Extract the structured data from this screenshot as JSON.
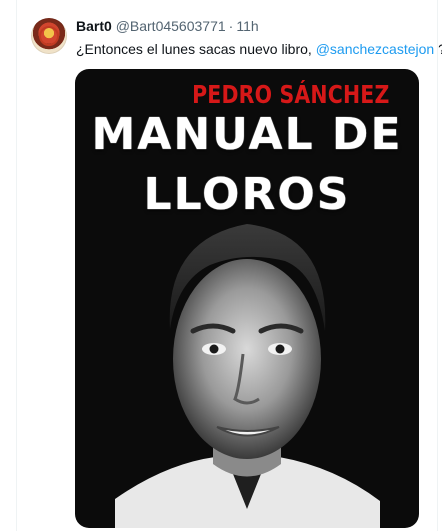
{
  "tweet": {
    "author_name": "Bart0",
    "handle": "@Bart045603771",
    "separator": "·",
    "time": "11h",
    "text_before": "¿Entonces el lunes sacas nuevo libro, ",
    "mention": "@sanchezcastejon",
    "text_after": " ?"
  },
  "media": {
    "book_author": "PEDRO SÁNCHEZ",
    "book_title_line1": "MANUAL DE",
    "book_title_line2": "LLOROS"
  },
  "colors": {
    "link": "#1d9bf0",
    "secondary_text": "#536471",
    "author_red": "#d61818"
  }
}
